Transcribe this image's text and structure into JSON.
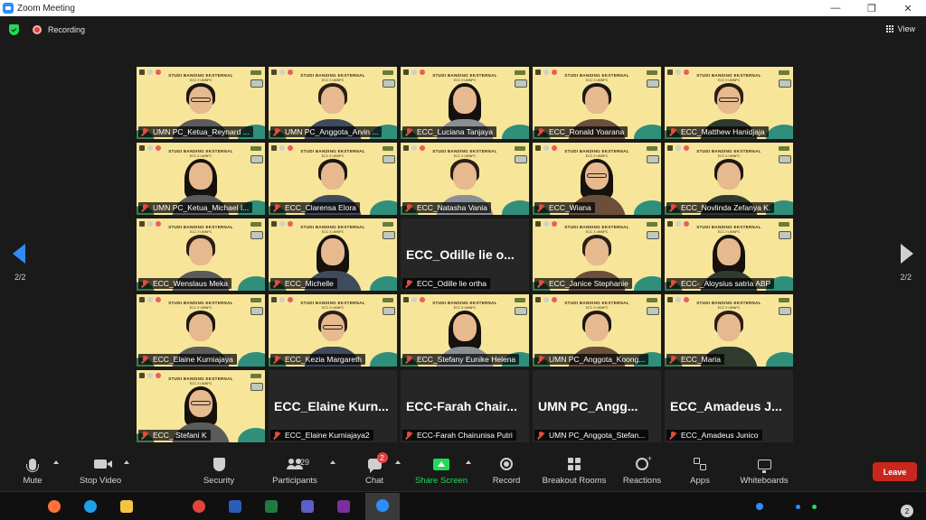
{
  "window": {
    "title": "Zoom Meeting",
    "controls": [
      "—",
      "❐",
      "✕"
    ]
  },
  "topbar": {
    "recording_label": "Recording",
    "view_label": "View"
  },
  "pagination": {
    "left": "2/2",
    "right": "2/2"
  },
  "banner": {
    "title": "STUDI BANDING EKSTERNAL",
    "subtitle": "ECC X UMNPC"
  },
  "participants": [
    {
      "name": "UMN PC_Ketua_Reynard ...",
      "video": true
    },
    {
      "name": "UMN PC_Anggota_Arvin ...",
      "video": true
    },
    {
      "name": "ECC_Luciana Tanjaya",
      "video": true
    },
    {
      "name": "ECC_Ronald Yoarana",
      "video": true
    },
    {
      "name": "ECC_Matthew Hanidjaja",
      "video": true
    },
    {
      "name": "UMN PC_Ketua_Michael I...",
      "video": true
    },
    {
      "name": "ECC_Clarensa Elora",
      "video": true
    },
    {
      "name": "ECC_Natasha Vania",
      "video": true
    },
    {
      "name": "ECC_Wiana",
      "video": true
    },
    {
      "name": "ECC_Novlinda Zefanya K.",
      "video": true
    },
    {
      "name": "ECC_Wenslaus Meka",
      "video": true
    },
    {
      "name": "ECC_Michelle",
      "video": true
    },
    {
      "name": "ECC_Odille lie ortha",
      "video": false,
      "big_label": "ECC_Odille lie o..."
    },
    {
      "name": "ECC_Janice Stephanie",
      "video": true
    },
    {
      "name": "ECC-_Aloysius satria ABP",
      "video": true
    },
    {
      "name": "ECC_Elaine Kurniajaya",
      "video": true
    },
    {
      "name": "ECC_Kezia Margareth",
      "video": true
    },
    {
      "name": "ECC_Stefany Eunike Helena",
      "video": true
    },
    {
      "name": "UMN PC_Anggota_Koong...",
      "video": true
    },
    {
      "name": "ECC_Maria",
      "video": true
    },
    {
      "name": "ECC_ Stefani K",
      "video": true
    },
    {
      "name": "ECC_Elaine Kurniajaya2",
      "video": false,
      "big_label": "ECC_Elaine Kurn..."
    },
    {
      "name": "ECC-Farah Chairunisa Putri",
      "video": false,
      "big_label": "ECC-Farah Chair..."
    },
    {
      "name": "UMN PC_Anggota_Stefan...",
      "video": false,
      "big_label": "UMN PC_Angg..."
    },
    {
      "name": "ECC_Amadeus Junico",
      "video": false,
      "big_label": "ECC_Amadeus J..."
    }
  ],
  "toolbar": {
    "mute": "Mute",
    "stop_video": "Stop Video",
    "security": "Security",
    "participants": "Participants",
    "participants_count": "29",
    "chat": "Chat",
    "chat_badge": "2",
    "share_screen": "Share Screen",
    "record": "Record",
    "breakout_rooms": "Breakout Rooms",
    "reactions": "Reactions",
    "apps": "Apps",
    "whiteboards": "Whiteboards",
    "leave": "Leave"
  },
  "taskbar": {
    "apps": [
      {
        "name": "firefox",
        "color": "#ff7139"
      },
      {
        "name": "edge",
        "color": "#1ea0e8"
      },
      {
        "name": "file-explorer",
        "color": "#f4c542"
      },
      {
        "name": "chrome",
        "color": "#e0463a"
      },
      {
        "name": "word",
        "color": "#2b5cb8"
      },
      {
        "name": "excel",
        "color": "#1f7a44"
      },
      {
        "name": "teams",
        "color": "#5b5fc7"
      },
      {
        "name": "onenote",
        "color": "#7b2f9e"
      },
      {
        "name": "zoom",
        "color": "#2d8cff"
      }
    ],
    "notification_count": "2"
  }
}
